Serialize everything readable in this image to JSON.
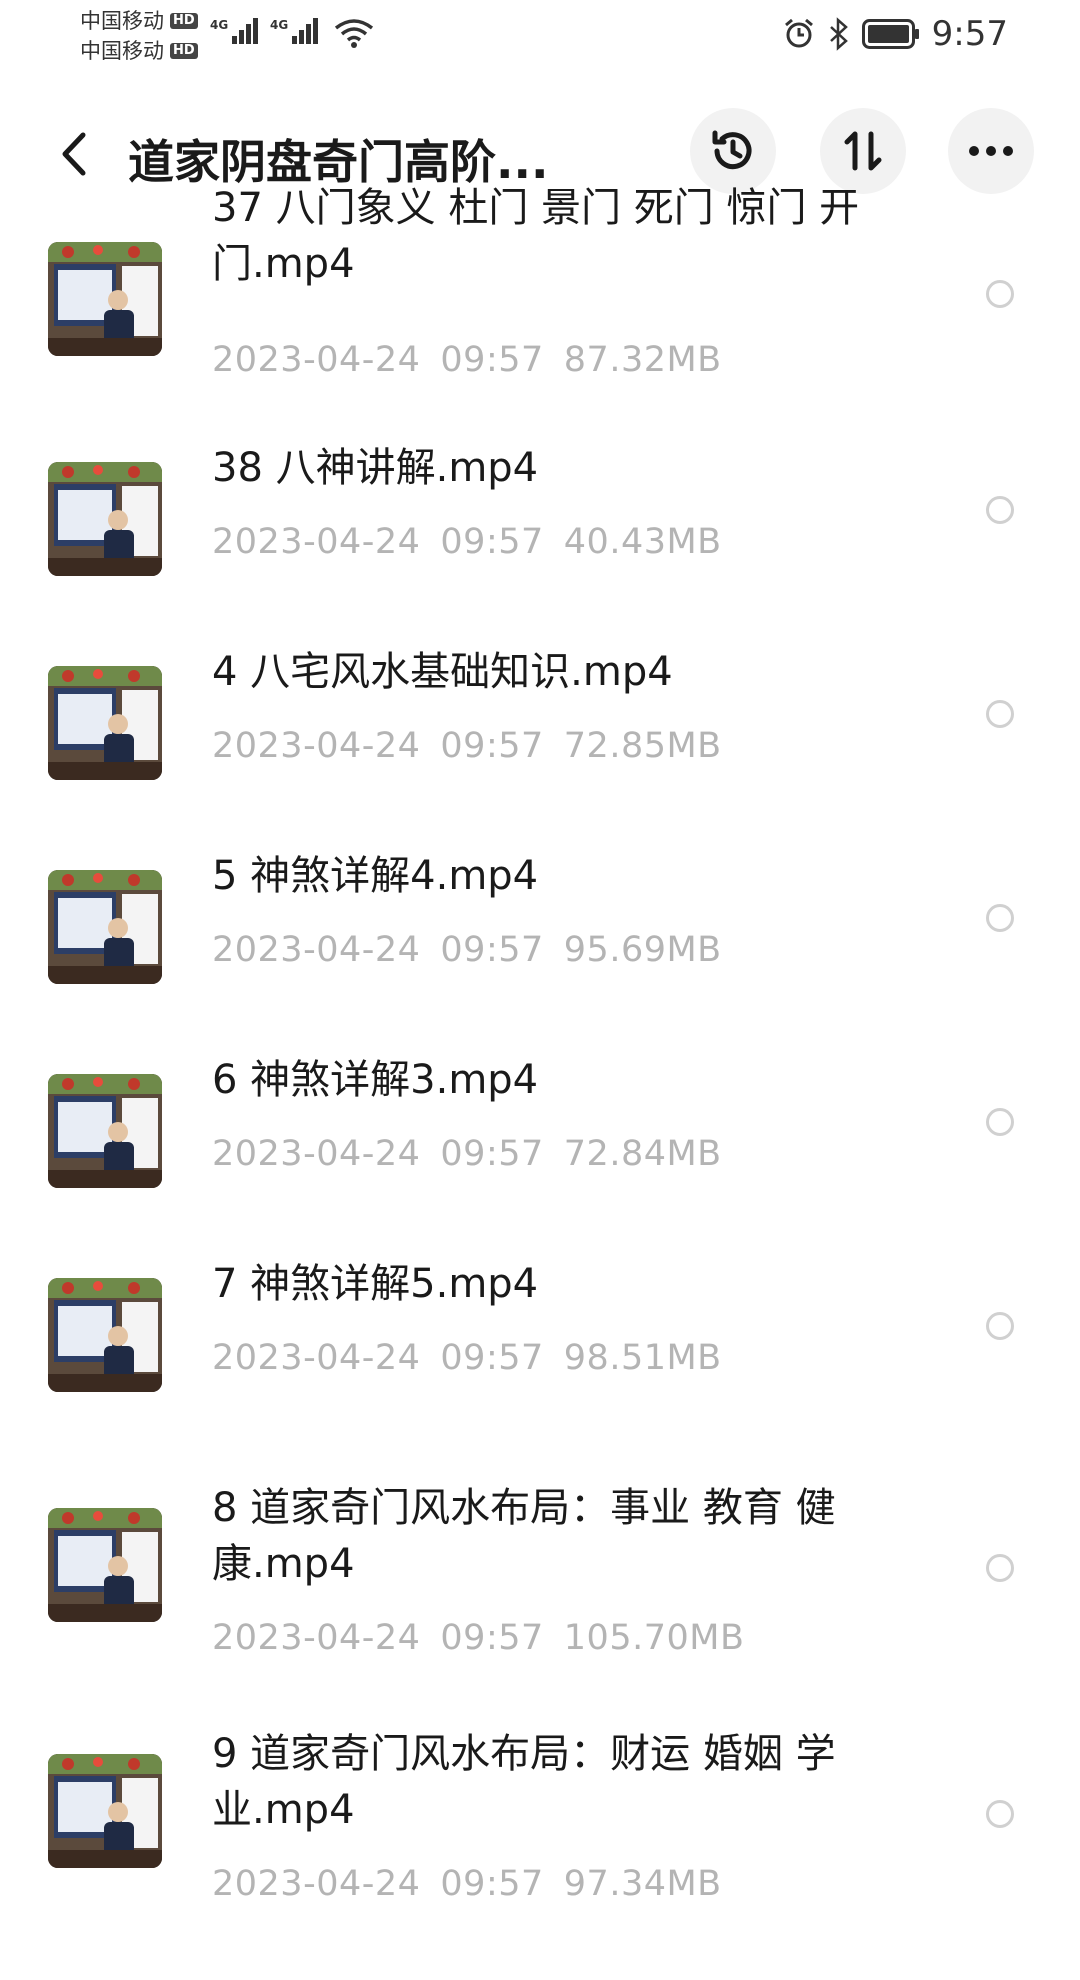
{
  "status_bar": {
    "carrier_1": "中国移动",
    "carrier_2": "中国移动",
    "hd_label": "HD",
    "network_label": "4G",
    "time": "9:57"
  },
  "header": {
    "title": "道家阴盘奇门高阶...",
    "icons": [
      "back-icon",
      "history-icon",
      "sort-icon",
      "more-icon"
    ]
  },
  "files": [
    {
      "name": "37 八门象义 杜门 景门 死门 惊门 开门.mp4",
      "date": "2023-04-24",
      "time": "09:57",
      "size": "87.32MB"
    },
    {
      "name": "38 八神讲解.mp4",
      "date": "2023-04-24",
      "time": "09:57",
      "size": "40.43MB"
    },
    {
      "name": "4 八宅风水基础知识.mp4",
      "date": "2023-04-24",
      "time": "09:57",
      "size": "72.85MB"
    },
    {
      "name": "5 神煞详解4.mp4",
      "date": "2023-04-24",
      "time": "09:57",
      "size": "95.69MB"
    },
    {
      "name": "6 神煞详解3.mp4",
      "date": "2023-04-24",
      "time": "09:57",
      "size": "72.84MB"
    },
    {
      "name": "7 神煞详解5.mp4",
      "date": "2023-04-24",
      "time": "09:57",
      "size": "98.51MB"
    },
    {
      "name": "8 道家奇门风水布局：事业 教育 健康.mp4",
      "date": "2023-04-24",
      "time": "09:57",
      "size": "105.70MB"
    },
    {
      "name": "9 道家奇门风水布局：财运 婚姻 学业.mp4",
      "date": "2023-04-24",
      "time": "09:57",
      "size": "97.34MB"
    }
  ]
}
